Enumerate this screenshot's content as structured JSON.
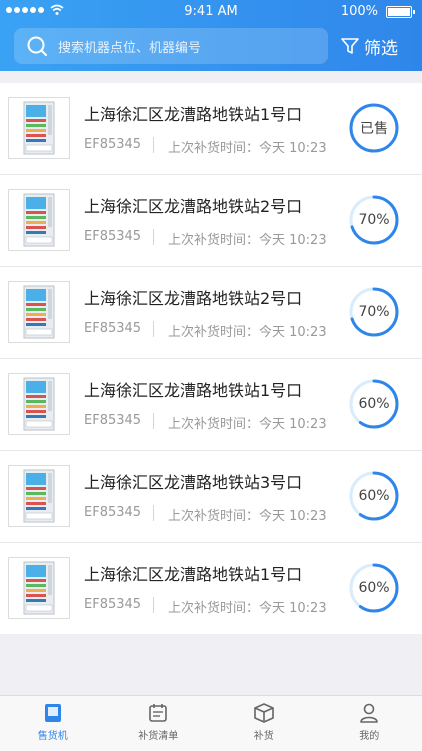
{
  "status_bar": {
    "time": "9:41 AM",
    "battery": "100%"
  },
  "header": {
    "search_placeholder": "搜索机器点位、机器编号",
    "filter_label": "筛选"
  },
  "machines": [
    {
      "location": "上海徐汇区龙漕路地铁站1号口",
      "code": "EF85345",
      "restock": "上次补货时间：今天 10:23",
      "status": "已售",
      "progress": 1.0
    },
    {
      "location": "上海徐汇区龙漕路地铁站2号口",
      "code": "EF85345",
      "restock": "上次补货时间：今天 10:23",
      "status": "70%",
      "progress": 0.7
    },
    {
      "location": "上海徐汇区龙漕路地铁站2号口",
      "code": "EF85345",
      "restock": "上次补货时间：今天 10:23",
      "status": "70%",
      "progress": 0.7
    },
    {
      "location": "上海徐汇区龙漕路地铁站1号口",
      "code": "EF85345",
      "restock": "上次补货时间：今天 10:23",
      "status": "60%",
      "progress": 0.6
    },
    {
      "location": "上海徐汇区龙漕路地铁站3号口",
      "code": "EF85345",
      "restock": "上次补货时间：今天 10:23",
      "status": "60%",
      "progress": 0.6
    },
    {
      "location": "上海徐汇区龙漕路地铁站1号口",
      "code": "EF85345",
      "restock": "上次补货时间：今天 10:23",
      "status": "60%",
      "progress": 0.6
    }
  ],
  "tabs": [
    {
      "label": "售货机",
      "icon": "vending-machine-icon",
      "active": true
    },
    {
      "label": "补货清单",
      "icon": "calendar-icon",
      "active": false
    },
    {
      "label": "补货",
      "icon": "box-icon",
      "active": false
    },
    {
      "label": "我的",
      "icon": "person-icon",
      "active": false
    }
  ],
  "colors": {
    "accent": "#2f86ea",
    "ring_track": "#d8ecfc"
  }
}
